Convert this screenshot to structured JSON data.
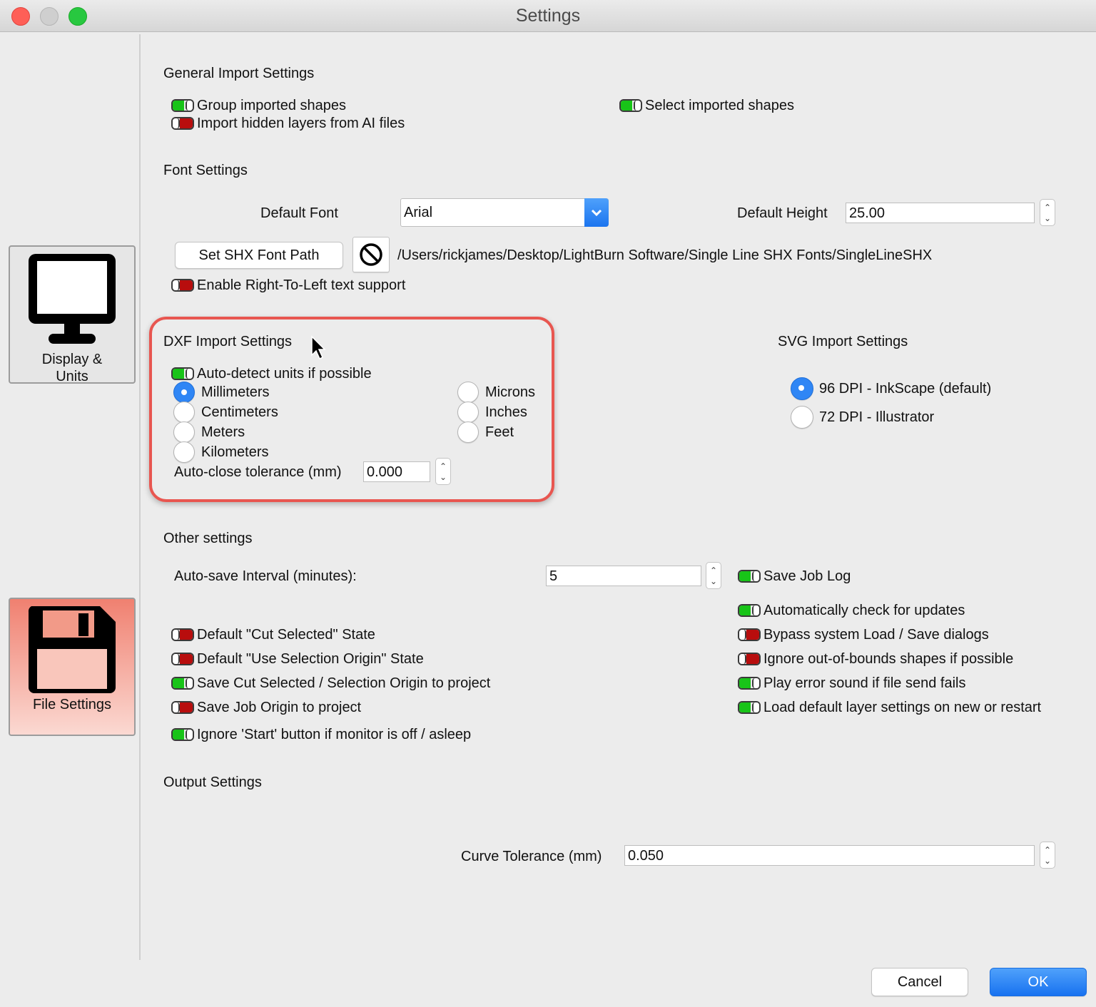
{
  "window": {
    "title": "Settings"
  },
  "sidebar": {
    "display_units": "Display & Units",
    "file_settings": "File Settings"
  },
  "general": {
    "heading": "General Import Settings",
    "group_shapes": {
      "label": "Group imported shapes",
      "on": true
    },
    "hidden_layers": {
      "label": "Import hidden layers from AI files",
      "on": false
    },
    "select_shapes": {
      "label": "Select imported shapes",
      "on": true
    }
  },
  "font": {
    "heading": "Font Settings",
    "default_font_label": "Default Font",
    "default_font_value": "Arial",
    "default_height_label": "Default Height",
    "default_height_value": "25.00",
    "shx_button": "Set SHX Font Path",
    "shx_path": "/Users/rickjames/Desktop/LightBurn Software/Single Line SHX Fonts/SingleLineSHX",
    "rtl": {
      "label": "Enable Right-To-Left text support",
      "on": false
    }
  },
  "dxf": {
    "heading": "DXF Import Settings",
    "auto_detect": {
      "label": "Auto-detect units if possible",
      "on": true
    },
    "units_left": [
      "Millimeters",
      "Centimeters",
      "Meters",
      "Kilometers"
    ],
    "units_right": [
      "Microns",
      "Inches",
      "Feet"
    ],
    "selected_unit": "Millimeters",
    "tolerance_label": "Auto-close tolerance (mm)",
    "tolerance_value": "0.000"
  },
  "svg": {
    "heading": "SVG Import Settings",
    "options": [
      "96 DPI - InkScape (default)",
      "72 DPI - Illustrator"
    ],
    "selected": "96 DPI - InkScape (default)"
  },
  "other": {
    "heading": "Other settings",
    "autosave_label": "Auto-save Interval (minutes):",
    "autosave_value": "5",
    "left_toggles": [
      {
        "label": "Default \"Cut Selected\" State",
        "on": false
      },
      {
        "label": "Default \"Use Selection Origin\" State",
        "on": false
      },
      {
        "label": "Save Cut Selected / Selection Origin to project",
        "on": true
      },
      {
        "label": "Save Job Origin to project",
        "on": false
      },
      {
        "label": "Ignore 'Start' button if monitor is off / asleep",
        "on": true
      }
    ],
    "right_toggles": [
      {
        "label": "Save Job Log",
        "on": true
      },
      {
        "label": "Automatically check for updates",
        "on": true
      },
      {
        "label": "Bypass system Load / Save dialogs",
        "on": false
      },
      {
        "label": "Ignore out-of-bounds shapes if possible",
        "on": false
      },
      {
        "label": "Play error sound if file send fails",
        "on": true
      },
      {
        "label": "Load default layer settings on new or restart",
        "on": true
      }
    ]
  },
  "output": {
    "heading": "Output Settings",
    "curve_label": "Curve Tolerance (mm)",
    "curve_value": "0.050"
  },
  "footer": {
    "cancel": "Cancel",
    "ok": "OK"
  },
  "colors": {
    "toggle_on": "#18c418",
    "toggle_off": "#b80d0d",
    "accent": "#2f86f5",
    "highlight": "#e85650",
    "file_settings_bg": "#f29a88"
  }
}
